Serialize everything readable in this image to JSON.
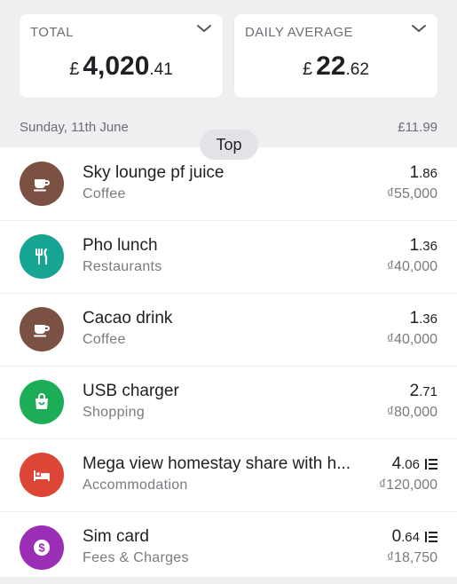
{
  "summary": {
    "total": {
      "label": "TOTAL",
      "currency": "£",
      "integer": "4,020",
      "decimals": ".41"
    },
    "daily_average": {
      "label": "DAILY AVERAGE",
      "currency": "£",
      "integer": "22",
      "decimals": ".62"
    }
  },
  "day_header": {
    "date": "Sunday, 11th June",
    "total": "£11.99"
  },
  "top_button": "Top",
  "transactions": [
    {
      "title": "Sky lounge pf juice",
      "category": "Coffee",
      "gbp_int": "1",
      "gbp_dec": ".86",
      "local": "₫55,000",
      "icon": "coffee-cup-icon",
      "color": "#7a5142",
      "notes": false
    },
    {
      "title": "Pho lunch",
      "category": "Restaurants",
      "gbp_int": "1",
      "gbp_dec": ".36",
      "local": "₫40,000",
      "icon": "fork-knife-icon",
      "color": "#15a592",
      "notes": false
    },
    {
      "title": "Cacao drink",
      "category": "Coffee",
      "gbp_int": "1",
      "gbp_dec": ".36",
      "local": "₫40,000",
      "icon": "coffee-cup-icon",
      "color": "#7a5142",
      "notes": false
    },
    {
      "title": "USB charger",
      "category": "Shopping",
      "gbp_int": "2",
      "gbp_dec": ".71",
      "local": "₫80,000",
      "icon": "shopping-bag-icon",
      "color": "#1cad57",
      "notes": false
    },
    {
      "title": "Mega view homestay share with h...",
      "category": "Accommodation",
      "gbp_int": "4",
      "gbp_dec": ".06",
      "local": "₫120,000",
      "icon": "bed-icon",
      "color": "#dd4536",
      "notes": true
    },
    {
      "title": "Sim card",
      "category": "Fees & Charges",
      "gbp_int": "0",
      "gbp_dec": ".64",
      "local": "₫18,750",
      "icon": "dollar-coin-icon",
      "color": "#9a2fb5",
      "notes": true
    }
  ]
}
